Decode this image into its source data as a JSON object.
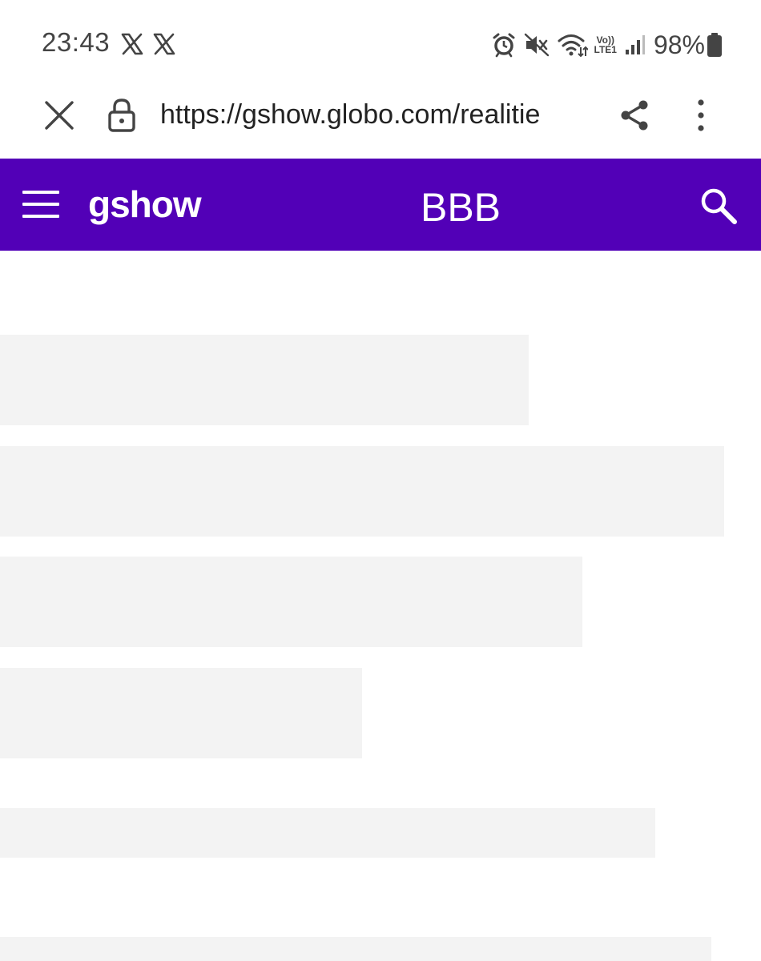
{
  "status_bar": {
    "time": "23:43",
    "notification_icons": [
      "x-logo-icon",
      "x-logo-icon"
    ],
    "system_icons": [
      "alarm-icon",
      "mute-icon",
      "wifi-icon",
      "volte-icon",
      "signal-icon"
    ],
    "volte_top": "Vo))",
    "volte_bottom": "LTE1",
    "battery_percent": "98%"
  },
  "url_bar": {
    "url": "https://gshow.globo.com/realitie",
    "secure": true
  },
  "site_header": {
    "background": "#5200b7",
    "logo_text": "gshow",
    "section_title": "BBB"
  },
  "skeleton": {
    "color": "#f3f3f3",
    "count": 6
  }
}
